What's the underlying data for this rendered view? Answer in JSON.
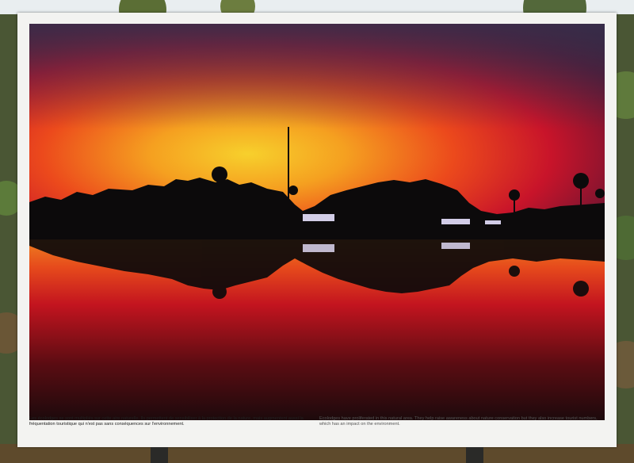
{
  "captions": {
    "french": "Les écolodges se sont multipliés sur cette aire naturelle. Ils permettent de sensibiliser à la protection de la nature, mais augmentent aussi la fréquentation touristique qui n'est pas sans conséquences sur l'environnement.",
    "english": "Ecolodges have proliferated in this natural area. They help raise awareness about nature conservation but they also increase tourist numbers, which has an impact on the environment."
  },
  "colors": {
    "sky_top": "#2e2540",
    "sky_red": "#d41a2a",
    "sky_orange": "#f58a1e",
    "horizon_yellow": "#f7c12a",
    "water_red": "#c0141f",
    "board": "#f3f3f1"
  }
}
